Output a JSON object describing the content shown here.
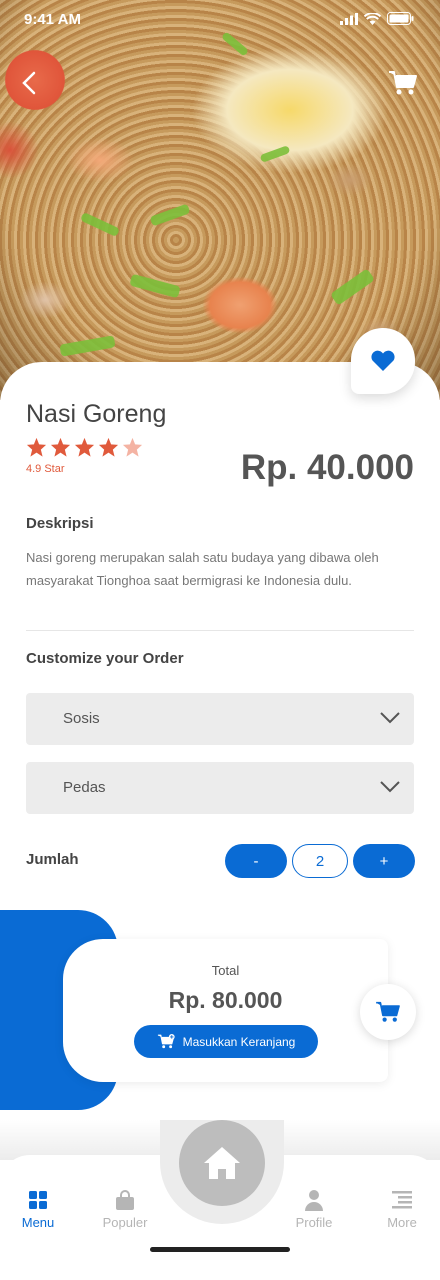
{
  "status_bar": {
    "time": "9:41 AM"
  },
  "product": {
    "name": "Nasi Goreng",
    "rating_value": 4.5,
    "rating_max": 5,
    "rating_text": "4.9 Star",
    "price": "Rp. 40.000"
  },
  "description": {
    "title": "Deskripsi",
    "text": "Nasi goreng merupakan salah satu budaya yang dibawa oleh masyarakat Tionghoa saat bermigrasi ke Indonesia dulu."
  },
  "customize": {
    "title": "Customize your Order",
    "option1": "Sosis",
    "option2": "Pedas",
    "qty_label": "Jumlah",
    "minus_label": "-",
    "qty_value": "2",
    "plus_label": "+"
  },
  "total": {
    "label": "Total",
    "value": "Rp. 80.000",
    "add_to_cart_label": "Masukkan Keranjang"
  },
  "bottom_nav": {
    "items": [
      {
        "label": "Menu",
        "icon": "grid-icon",
        "active": true
      },
      {
        "label": "Populer",
        "icon": "bag-icon",
        "active": false
      },
      {
        "label": "Home",
        "icon": "home-icon",
        "active": false
      },
      {
        "label": "Profile",
        "icon": "person-icon",
        "active": false
      },
      {
        "label": "More",
        "icon": "menu-lines-icon",
        "active": false
      }
    ]
  },
  "colors": {
    "primary": "#0a6bd4",
    "star": "#e05a3c",
    "text_dark": "#444444",
    "inactive": "#b5b5b5"
  }
}
